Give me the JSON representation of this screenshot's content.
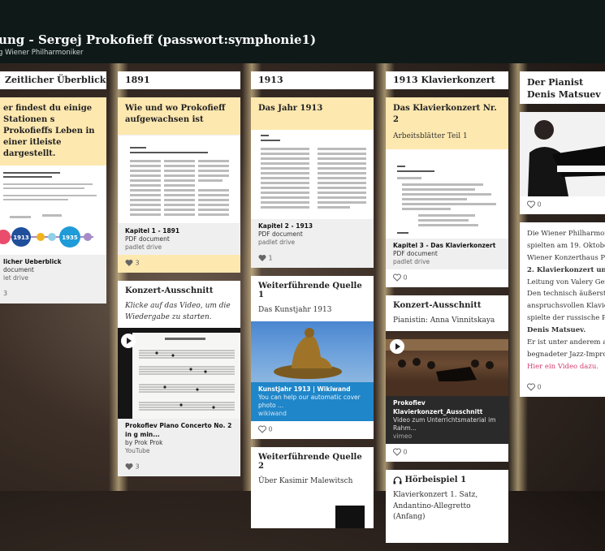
{
  "header": {
    "title": "ung - Sergej Prokofieff (passwort:symphonie1)",
    "subtitle": "g Wiener Philharmoniker"
  },
  "columns": [
    {
      "heading": "Zeitlicher Überblick",
      "cards": [
        {
          "title": "er findest du einige Stationen s Prokofieffs Leben in einer itleiste dargestellt.",
          "attachment": {
            "name": "licher Ueberblick",
            "type": "document",
            "source": "let drive"
          },
          "likes": "3",
          "timeline_labels": [
            "1891",
            "1913",
            "1935"
          ]
        }
      ]
    },
    {
      "heading": "1891",
      "cards": [
        {
          "title": "Wie und wo Prokofieff aufgewachsen ist",
          "attachment": {
            "name": "Kapitel 1 - 1891",
            "type": "PDF document",
            "source": "padlet drive"
          },
          "likes": "3"
        },
        {
          "title": "Konzert-Ausschnitt",
          "body": "Klicke auf das Video, um die Wiedergabe zu starten.",
          "attachment": {
            "name": "Prokofiev Piano Concerto No. 2 in g min...",
            "type": "by Prok Prok",
            "source": "YouTube"
          },
          "likes": "3"
        }
      ]
    },
    {
      "heading": "1913",
      "cards": [
        {
          "title": "Das Jahr 1913",
          "attachment": {
            "name": "Kapitel 2 - 1913",
            "type": "PDF document",
            "source": "padlet drive"
          },
          "likes": "1"
        },
        {
          "title": "Weiterführende Quelle 1",
          "subtitle": "Das Kunstjahr 1913",
          "attachment": {
            "name": "Kunstjahr 1913 | Wikiwand",
            "type": "You can help our automatic cover photo ...",
            "source": "wikiwand"
          },
          "likes": "0"
        },
        {
          "title": "Weiterführende Quelle 2",
          "subtitle": "Über Kasimir Malewitsch"
        }
      ]
    },
    {
      "heading": "1913  Klavierkonzert",
      "cards": [
        {
          "title": "Das Klavierkonzert Nr. 2",
          "subtitle": "Arbeitsblätter Teil 1",
          "attachment": {
            "name": "Kapitel 3 - Das Klavierkonzert",
            "type": "PDF document",
            "source": "padlet drive"
          },
          "likes": "0"
        },
        {
          "title": "Konzert-Ausschnitt",
          "subtitle": "Pianistin: Anna Vinnitskaya",
          "attachment": {
            "name": "Prokofiev Klavierkonzert_Ausschnitt",
            "type": "Video zum Unterrichtsmaterial im Rahm...",
            "source": "vimeo"
          },
          "likes": "0"
        },
        {
          "title": "Hörbeispiel 1",
          "subtitle": "Klavierkonzert 1. Satz, Andantino-Allegretto (Anfang)"
        }
      ]
    },
    {
      "heading": "Der Pianist Denis Matsuev",
      "cards": [
        {
          "likes": "0"
        },
        {
          "text_lines": [
            "Die Wiener Philharmonik",
            "spielten am 19. Oktober 2",
            "Wiener Konzerthaus Pro",
            "2. Klavierkonzert unter",
            "Leitung von Valery Gergi",
            "Den technisch äußerst",
            "anspruchsvollen Klavierp",
            "spielte der russische Pian",
            "Denis Matsuev.",
            "Er ist unter anderem auc",
            "begnadeter Jazz-Improvi"
          ],
          "link": "Hier ein Video dazu.",
          "likes": "0"
        }
      ]
    }
  ],
  "colors": {
    "topbar": "#0f1a18",
    "card_header": "#fde8b0",
    "link": "#d23a6e"
  }
}
